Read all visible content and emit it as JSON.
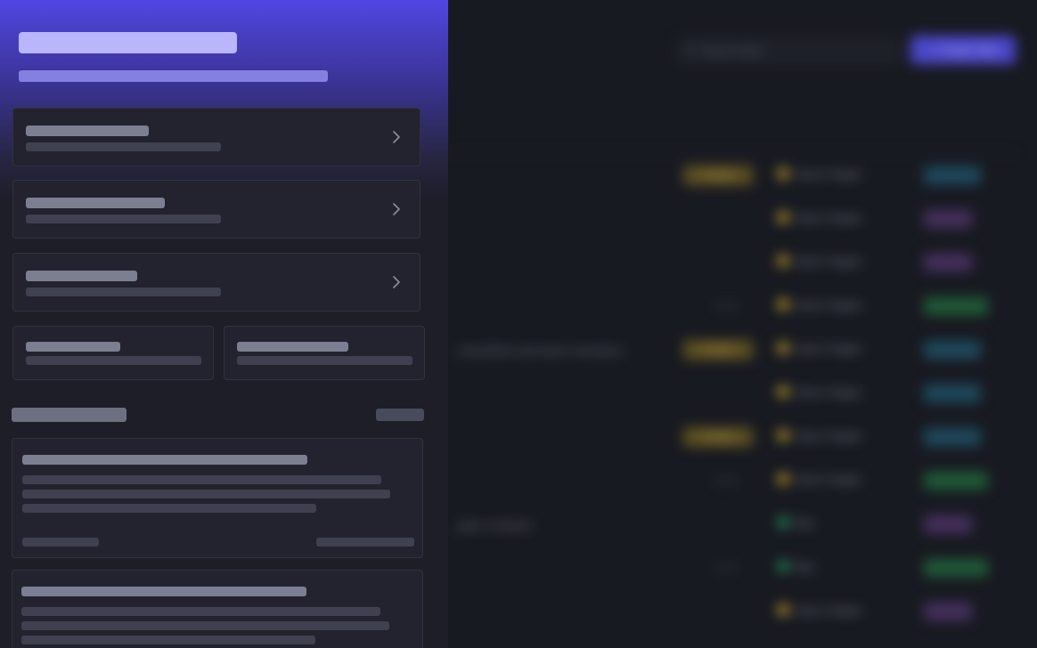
{
  "background": {
    "search": {
      "placeholder": "Search tasks",
      "icon": "search-icon"
    },
    "primary_button": {
      "label": "Create Task",
      "icon": "plus-icon"
    },
    "rows": [
      {
        "title": "",
        "flag": "Priority",
        "count": "",
        "member": "Jason Hagan",
        "dot": "#b8962c",
        "status": "cyan"
      },
      {
        "title": "",
        "flag": "",
        "count": "",
        "member": "Jason Hagan",
        "dot": "#b8962c",
        "status": "purple"
      },
      {
        "title": "",
        "flag": "",
        "count": "",
        "member": "Jason Hagan",
        "dot": "#b8962c",
        "status": "purple"
      },
      {
        "title": "",
        "flag": "",
        "count": "2 / 3",
        "member": "Jason Hagan",
        "dot": "#b8962c",
        "status": "green"
      },
      {
        "title": "...sheet/find and team members",
        "flag": "Priority",
        "count": "",
        "member": "Jason Hagan",
        "dot": "#b8962c",
        "status": "cyan"
      },
      {
        "title": "",
        "flag": "",
        "count": "",
        "member": "Jason Hagan",
        "dot": "#b8962c",
        "status": "cyan"
      },
      {
        "title": "",
        "flag": "Priority",
        "count": "",
        "member": "Jason Hagan",
        "dot": "#b8962c",
        "status": "cyan"
      },
      {
        "title": "",
        "flag": "",
        "count": "2 / 3",
        "member": "Jason Hagan",
        "dot": "#b8962c",
        "status": "green"
      },
      {
        "title": "...gain contacts",
        "flag": "",
        "count": "",
        "member": "Ray",
        "dot": "#1d8a5c",
        "status": "purple"
      },
      {
        "title": "",
        "flag": "",
        "count": "1 / 2",
        "member": "Ray",
        "dot": "#1d8a5c",
        "status": "green"
      },
      {
        "title": "",
        "flag": "",
        "count": "",
        "member": "Jason Hagan",
        "dot": "#b8962c",
        "status": "purple"
      }
    ]
  },
  "panel": {
    "accent": "#5046e2",
    "nav_cards": [
      {
        "icon": "chevron-right-icon"
      },
      {
        "icon": "chevron-right-icon"
      },
      {
        "icon": "chevron-right-icon"
      }
    ]
  }
}
